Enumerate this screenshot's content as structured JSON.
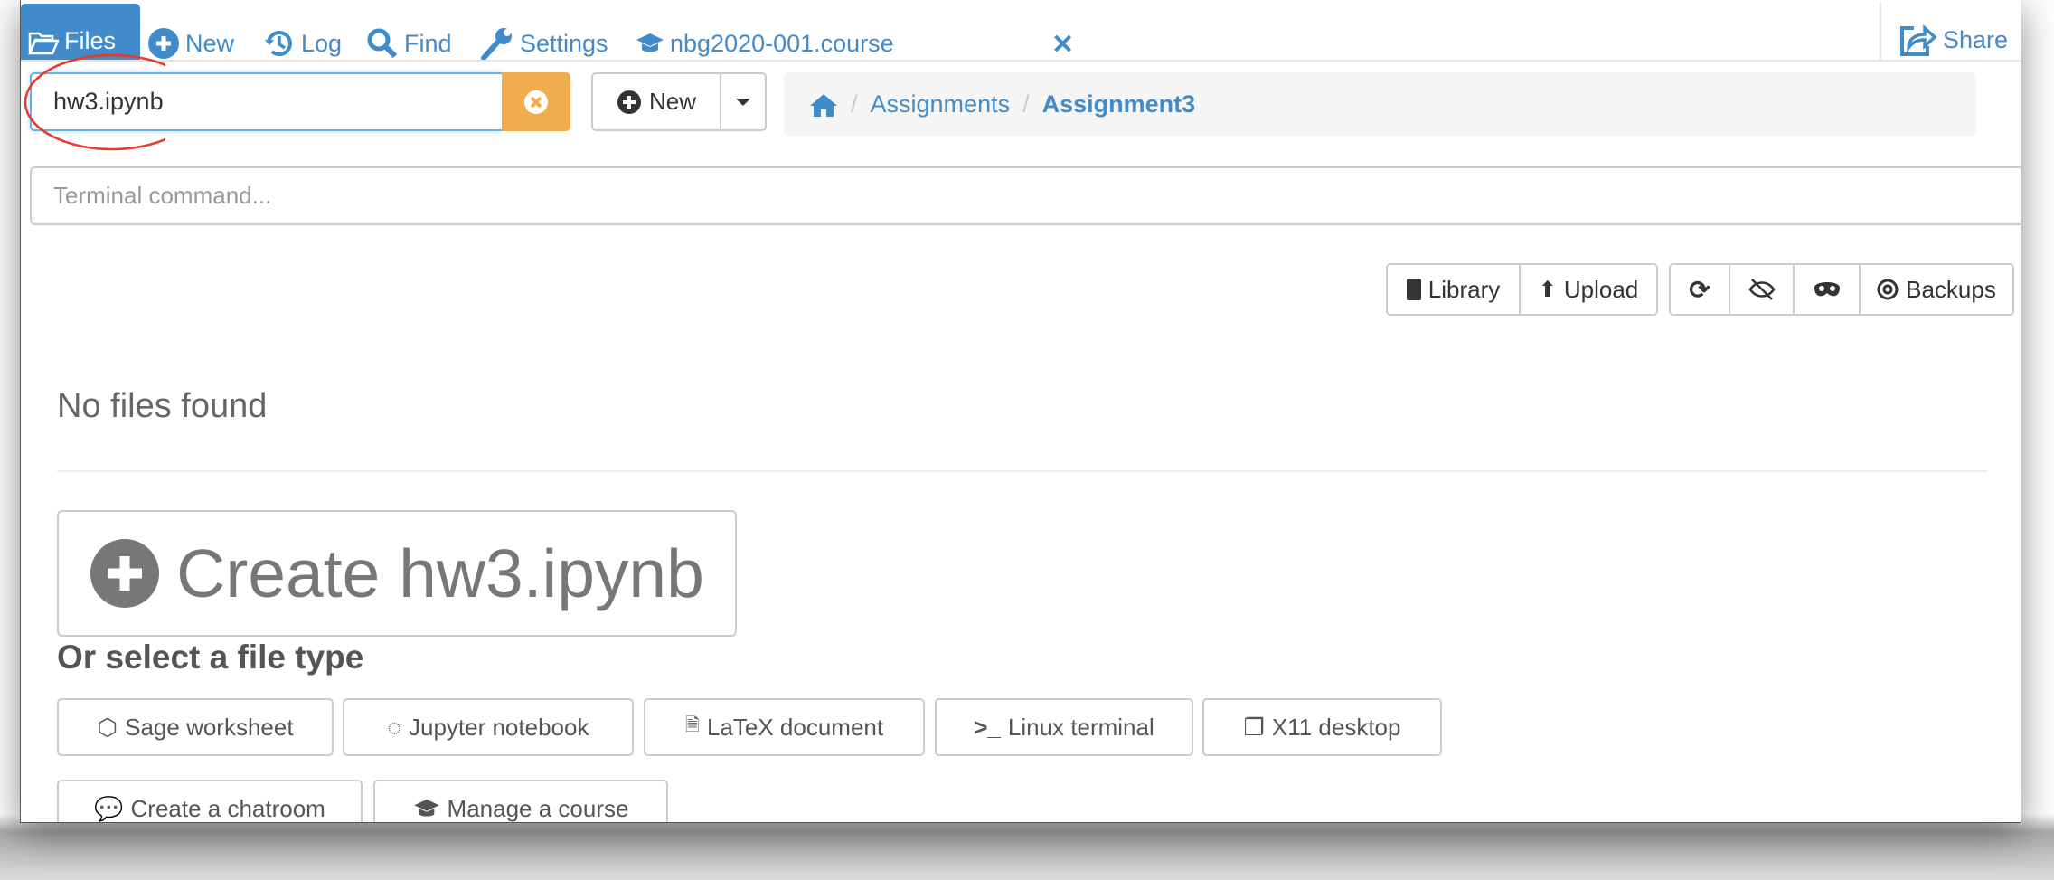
{
  "topnav": {
    "files": "Files",
    "new": "New",
    "log": "Log",
    "find": "Find",
    "settings": "Settings",
    "course": "nbg2020-001.course",
    "share": "Share"
  },
  "search": {
    "value": "hw3.ipynb"
  },
  "new_button": {
    "label": "New"
  },
  "breadcrumb": {
    "items": [
      "Assignments",
      "Assignment3"
    ]
  },
  "terminal": {
    "placeholder": "Terminal command..."
  },
  "toolbar": {
    "library": "Library",
    "upload": "Upload",
    "backups": "Backups"
  },
  "main": {
    "empty": "No files found",
    "create_label": "Create hw3.ipynb",
    "or_select": "Or select a file type",
    "file_types": [
      "Sage worksheet",
      "Jupyter notebook",
      "LaTeX document",
      "Linux terminal",
      "X11 desktop",
      "Create a chatroom",
      "Manage a course"
    ]
  },
  "colors": {
    "accent": "#428bca",
    "clear": "#f0ad4e",
    "annotation": "#e8392b"
  }
}
